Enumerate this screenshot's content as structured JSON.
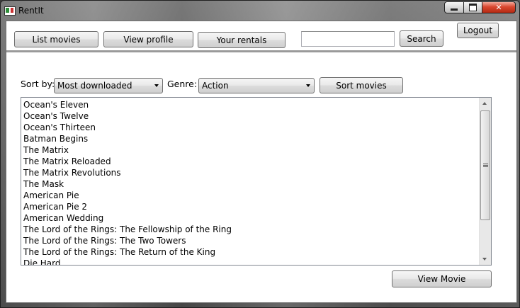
{
  "window": {
    "title": "RentIt"
  },
  "toolbar": {
    "list_movies": "List movies",
    "view_profile": "View profile",
    "your_rentals": "Your rentals",
    "search_value": "",
    "search_button": "Search",
    "logout": "Logout"
  },
  "filters": {
    "sort_by_label": "Sort by:",
    "sort_by_value": "Most downloaded",
    "genre_label": "Genre:",
    "genre_value": "Action",
    "sort_button": "Sort movies"
  },
  "movies": [
    "Ocean's Eleven",
    "Ocean's Twelve",
    "Ocean's Thirteen",
    "Batman Begins",
    "The Matrix",
    "The Matrix Reloaded",
    "The Matrix Revolutions",
    "The Mask",
    "American Pie",
    "American Pie 2",
    "American Wedding",
    "The Lord of the Rings: The Fellowship of the Ring",
    "The Lord of the Rings: The Two Towers",
    "The Lord of the Rings: The Return of the King",
    "Die Hard"
  ],
  "footer": {
    "view_movie": "View Movie"
  },
  "icons": {
    "app": "app-icon",
    "minimize": "minimize-icon",
    "maximize": "maximize-icon",
    "close": "close-icon"
  }
}
